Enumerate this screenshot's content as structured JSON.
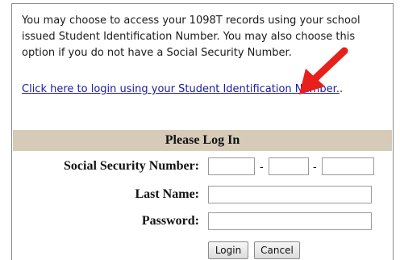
{
  "intro": {
    "text": "You may choose to access your 1098T records using your school issued Student Identification Number. You may also choose this option if you do not have a Social Security Number.",
    "link_text": "Click here to login using your Student Identification Number.",
    "link_suffix": "."
  },
  "login_form": {
    "header": "Please Log In",
    "ssn_label": "Social Security Number:",
    "ssn_separator": "-",
    "ssn_part1_value": "",
    "ssn_part2_value": "",
    "ssn_part3_value": "",
    "last_name_label": "Last Name:",
    "last_name_value": "",
    "password_label": "Password:",
    "password_value": "",
    "login_label": "Login",
    "cancel_label": "Cancel"
  },
  "colors": {
    "header_background": "#d6cbb8",
    "link": "#1a1aa6",
    "arrow": "#e8201c",
    "border": "#8a8a8a"
  },
  "icons": {
    "annotation": "red-arrow-icon"
  }
}
